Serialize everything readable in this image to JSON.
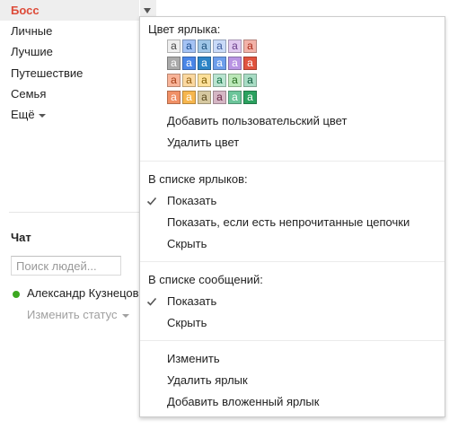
{
  "sidebar": {
    "active_label": "Босс",
    "labels": [
      "Личные",
      "Лучшие",
      "Путешествие",
      "Семья"
    ],
    "more_label": "Ещё"
  },
  "chat": {
    "title": "Чат",
    "search_placeholder": "Поиск людей...",
    "contact_name": "Александр Кузнецов",
    "status_text": "Изменить статус"
  },
  "menu": {
    "label_color_heading": "Цвет ярлыка:",
    "swatch_letter": "a",
    "swatches": [
      [
        {
          "bg": "#eeeeee",
          "fg": "#444444"
        },
        {
          "bg": "#a4c2f4",
          "fg": "#1a4c8a"
        },
        {
          "bg": "#9fc6e7",
          "fg": "#1c4f7a"
        },
        {
          "bg": "#c9daf8",
          "fg": "#3c5a99"
        },
        {
          "bg": "#e0c9f0",
          "fg": "#6a3d8a"
        },
        {
          "bg": "#f2b2a8",
          "fg": "#a82a1b"
        }
      ],
      [
        {
          "bg": "#aaaaaa",
          "fg": "#ffffff"
        },
        {
          "bg": "#4a86e8",
          "fg": "#ffffff"
        },
        {
          "bg": "#2d84c6",
          "fg": "#ffffff"
        },
        {
          "bg": "#6d9eeb",
          "fg": "#ffffff"
        },
        {
          "bg": "#b994e3",
          "fg": "#ffffff"
        },
        {
          "bg": "#e0533e",
          "fg": "#ffffff"
        }
      ],
      [
        {
          "bg": "#f8b499",
          "fg": "#a23b13"
        },
        {
          "bg": "#fbd8a0",
          "fg": "#8f5a0b"
        },
        {
          "bg": "#fde09a",
          "fg": "#7a5a00"
        },
        {
          "bg": "#b9e4d0",
          "fg": "#0d6a3e"
        },
        {
          "bg": "#bbe8b8",
          "fg": "#276a1e"
        },
        {
          "bg": "#a8dcc4",
          "fg": "#0e5a3c"
        }
      ],
      [
        {
          "bg": "#f09066",
          "fg": "#ffffff"
        },
        {
          "bg": "#f6b64e",
          "fg": "#ffffff"
        },
        {
          "bg": "#d6c8a0",
          "fg": "#5a4a1e"
        },
        {
          "bg": "#d5b6c4",
          "fg": "#6a2a48"
        },
        {
          "bg": "#6cc59a",
          "fg": "#ffffff"
        },
        {
          "bg": "#2ba15f",
          "fg": "#ffffff"
        }
      ]
    ],
    "add_custom_color": "Добавить пользовательский цвет",
    "remove_color": "Удалить цвет",
    "in_label_list_heading": "В списке ярлыков:",
    "show": "Показать",
    "show_if_unread": "Показать, если есть непрочитанные цепочки",
    "hide": "Скрыть",
    "in_message_list_heading": "В списке сообщений:",
    "msg_show": "Показать",
    "msg_hide": "Скрыть",
    "edit": "Изменить",
    "delete_label": "Удалить ярлык",
    "add_sublabel": "Добавить вложенный ярлык"
  },
  "colors": {
    "active_label": "#dd4b39",
    "online": "#3ca821",
    "muted_text": "#a0a0a0"
  }
}
